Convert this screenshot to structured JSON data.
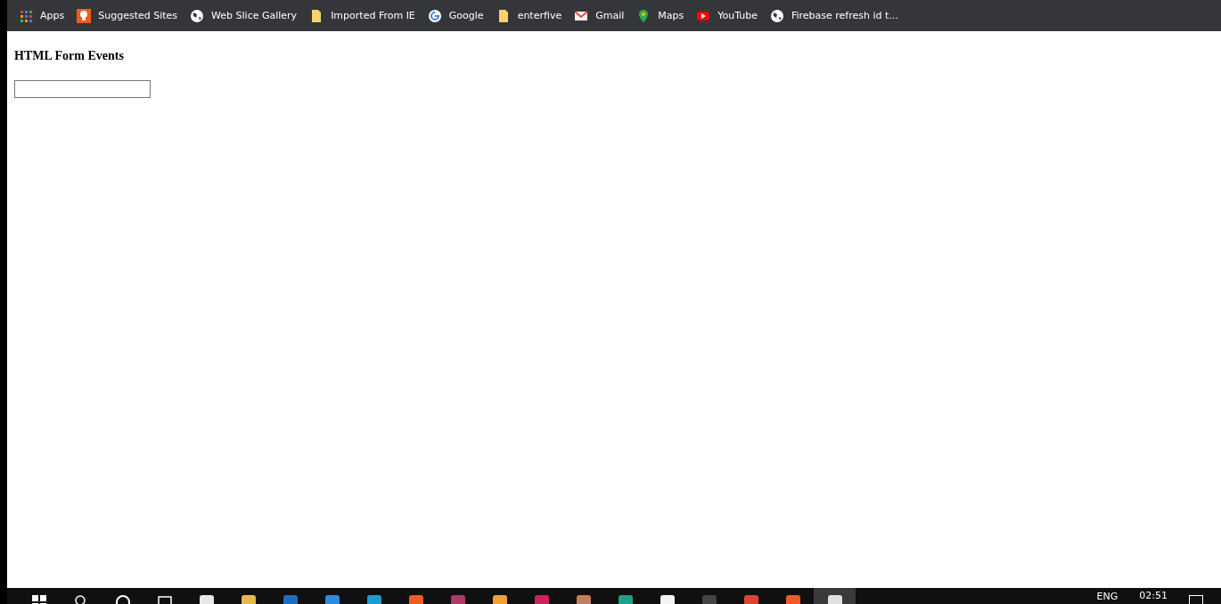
{
  "bookmarks_bar": [
    {
      "kind": "apps",
      "label": "Apps"
    },
    {
      "kind": "bulb",
      "label": "Suggested Sites"
    },
    {
      "kind": "globe",
      "label": "Web Slice Gallery"
    },
    {
      "kind": "folder",
      "label": "Imported From IE"
    },
    {
      "kind": "google",
      "label": "Google"
    },
    {
      "kind": "folder",
      "label": "enterfive"
    },
    {
      "kind": "gmail",
      "label": "Gmail"
    },
    {
      "kind": "maps",
      "label": "Maps"
    },
    {
      "kind": "youtube",
      "label": "YouTube"
    },
    {
      "kind": "globe",
      "label": "Firebase refresh id t..."
    }
  ],
  "page": {
    "heading": "HTML Form Events"
  },
  "taskbar": {
    "apps": [
      {
        "kind": "windows",
        "selected": false
      },
      {
        "kind": "search",
        "selected": false
      },
      {
        "kind": "cortana",
        "selected": false
      },
      {
        "kind": "taskview",
        "selected": false
      },
      {
        "kind": "store",
        "selected": false
      },
      {
        "kind": "explorer",
        "selected": false
      },
      {
        "kind": "mail",
        "selected": false
      },
      {
        "kind": "vscode",
        "selected": false
      },
      {
        "kind": "edge",
        "selected": false
      },
      {
        "kind": "brave",
        "selected": false
      },
      {
        "kind": "onenote",
        "selected": false
      },
      {
        "kind": "paint",
        "selected": false
      },
      {
        "kind": "intellij",
        "selected": false
      },
      {
        "kind": "pencil",
        "selected": false
      },
      {
        "kind": "pycharm",
        "selected": false
      },
      {
        "kind": "drive",
        "selected": false
      },
      {
        "kind": "terminal",
        "selected": false
      },
      {
        "kind": "chrome",
        "selected": false
      },
      {
        "kind": "brave",
        "selected": false
      },
      {
        "kind": "notepad",
        "selected": true
      }
    ],
    "language": "ENG",
    "time": "02:51"
  }
}
